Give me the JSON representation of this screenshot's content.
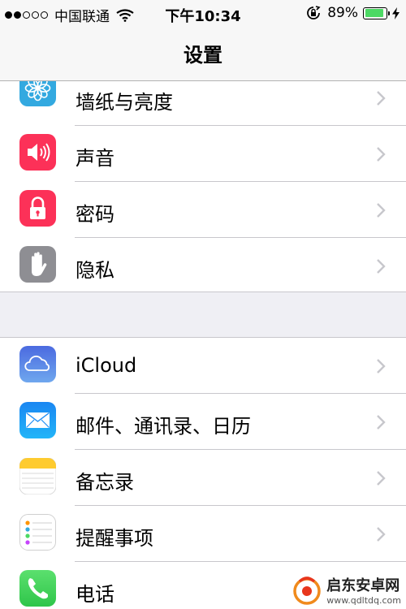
{
  "status_bar": {
    "carrier": "中国联通",
    "time": "下午10:34",
    "battery_percent": "89%",
    "battery_level": 0.89,
    "signal_bars_filled": 2,
    "signal_bars_total": 5
  },
  "navbar": {
    "title": "设置"
  },
  "group1": {
    "items": [
      {
        "label": "墙纸与亮度",
        "icon": "wallpaper-icon",
        "color": "#33a9e0"
      },
      {
        "label": "声音",
        "icon": "speaker-icon",
        "color": "#fc3158"
      },
      {
        "label": "密码",
        "icon": "lock-icon",
        "color": "#fc3158"
      },
      {
        "label": "隐私",
        "icon": "hand-icon",
        "color": "#8e8e93"
      }
    ]
  },
  "group2": {
    "items": [
      {
        "label": "iCloud",
        "icon": "cloud-icon",
        "color": "#5a6ee0"
      },
      {
        "label": "邮件、通讯录、日历",
        "icon": "mail-icon",
        "color": "#1e8ef5"
      },
      {
        "label": "备忘录",
        "icon": "notes-icon",
        "color": "#fecb2f"
      },
      {
        "label": "提醒事项",
        "icon": "reminders-icon",
        "color": "#ffffff"
      },
      {
        "label": "电话",
        "icon": "phone-icon",
        "color": "#4cd964"
      }
    ]
  },
  "watermark": {
    "name": "启东安卓网",
    "url": "www.qdltdq.com"
  }
}
